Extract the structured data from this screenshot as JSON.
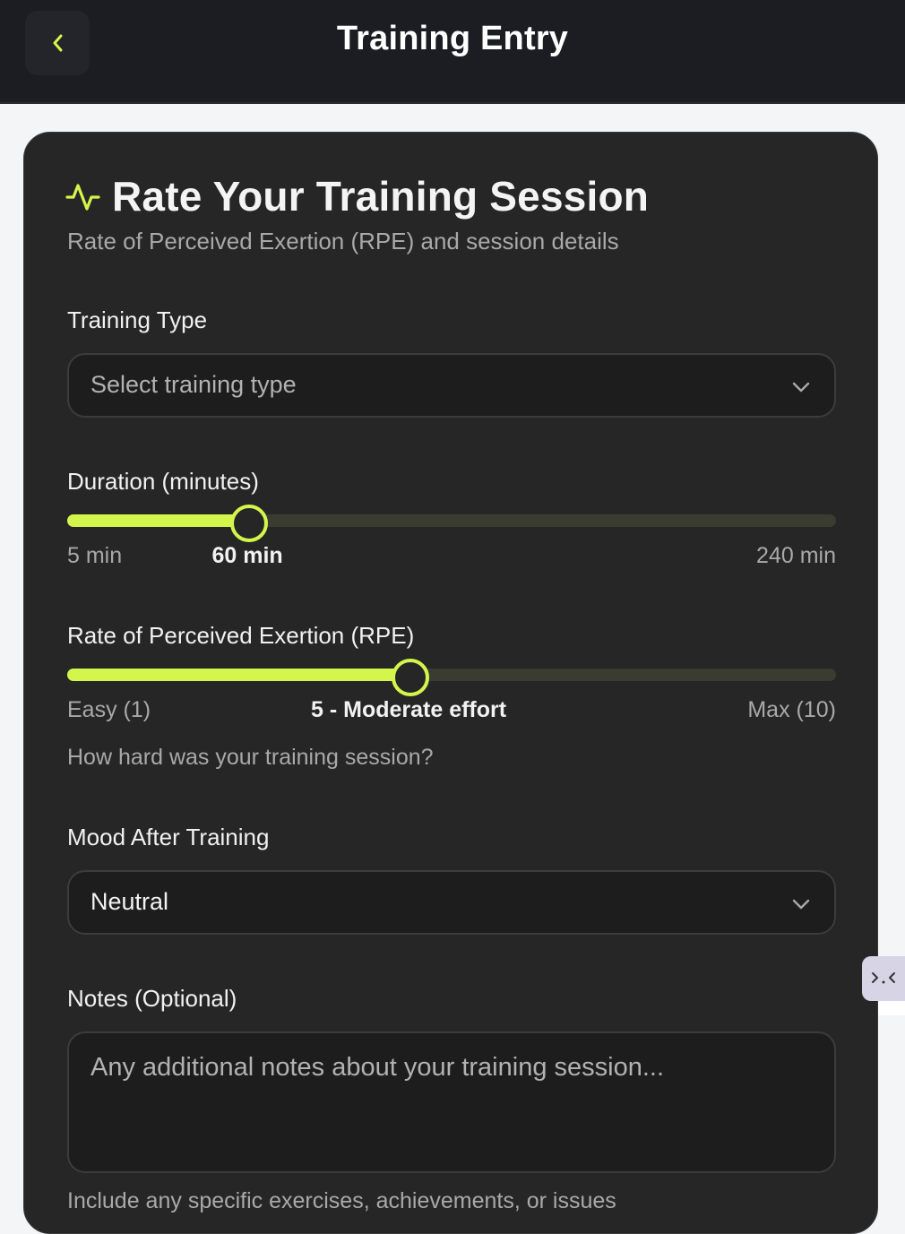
{
  "header": {
    "title": "Training Entry",
    "back_icon": "chevron-left-icon"
  },
  "colors": {
    "accent": "#d4f64c",
    "header_bg": "#1c1d22",
    "card_bg": "#262626",
    "page_bg": "#f4f5f7"
  },
  "card": {
    "icon": "activity-pulse-icon",
    "title": "Rate Your Training Session",
    "subtitle": "Rate of Perceived Exertion (RPE) and session details"
  },
  "training_type": {
    "label": "Training Type",
    "placeholder": "Select training type",
    "value": ""
  },
  "duration": {
    "label": "Duration (minutes)",
    "min": 5,
    "max": 240,
    "value": 60,
    "min_label": "5 min",
    "max_label": "240 min",
    "value_label": "60 min"
  },
  "rpe": {
    "label": "Rate of Perceived Exertion (RPE)",
    "min": 1,
    "max": 10,
    "value": 5,
    "min_label": "Easy (1)",
    "max_label": "Max (10)",
    "value_label": "5 - Moderate effort",
    "help": "How hard was your training session?"
  },
  "mood": {
    "label": "Mood After Training",
    "value": "Neutral"
  },
  "notes": {
    "label": "Notes (Optional)",
    "placeholder": "Any additional notes about your training session...",
    "help": "Include any specific exercises, achievements, or issues"
  }
}
